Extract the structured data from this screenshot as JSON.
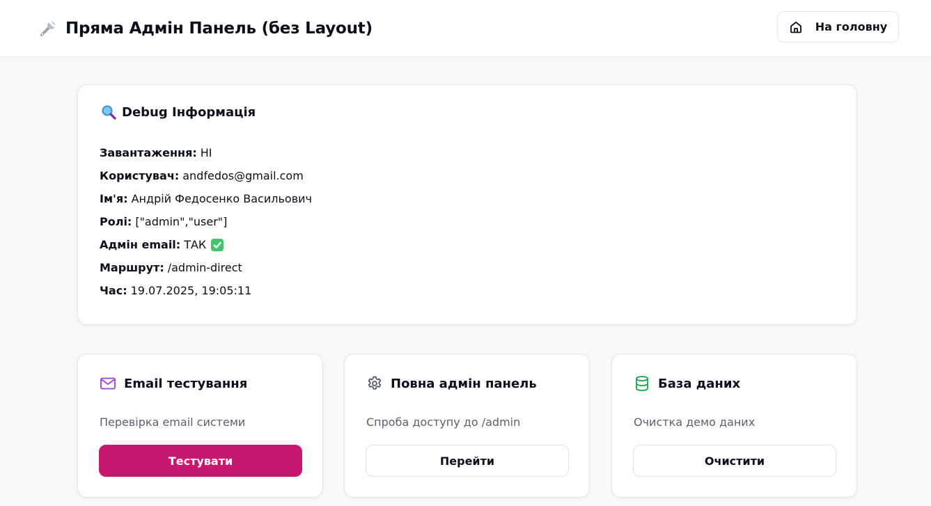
{
  "header": {
    "icon": "wrench-icon",
    "title": "Пряма Адмін Панель (без Layout)",
    "home_button": {
      "icon": "home-icon",
      "label": "На головну"
    }
  },
  "debug": {
    "icon": "magnifier-icon",
    "title": "Debug Інформація",
    "rows": [
      {
        "key": "Завантаження:",
        "value": "НІ"
      },
      {
        "key": "Користувач:",
        "value": "andfedos@gmail.com"
      },
      {
        "key": "Ім'я:",
        "value": "Андрій Федосенко Васильович"
      },
      {
        "key": "Ролі:",
        "value": "[\"admin\",\"user\"]"
      },
      {
        "key": "Адмін email:",
        "value": "ТАК",
        "badge": "check-icon"
      },
      {
        "key": "Маршрут:",
        "value": "/admin-direct"
      },
      {
        "key": "Час:",
        "value": "19.07.2025, 19:05:11"
      }
    ]
  },
  "cards": [
    {
      "icon": "mail-icon",
      "icon_color": "#9b3fe0",
      "title": "Email тестування",
      "description": "Перевірка email системи",
      "button": "Тестувати",
      "button_style": "primary"
    },
    {
      "icon": "gear-icon",
      "icon_color": "#4b5563",
      "title": "Повна адмін панель",
      "description": "Спроба доступу до /admin",
      "button": "Перейти",
      "button_style": "outline"
    },
    {
      "icon": "database-icon",
      "icon_color": "#16a34a",
      "title": "База даних",
      "description": "Очистка демо даних",
      "button": "Очистити",
      "button_style": "outline"
    }
  ],
  "colors": {
    "accent": "#c8176f",
    "background": "#f7f8f9",
    "check": "#43c46b"
  }
}
